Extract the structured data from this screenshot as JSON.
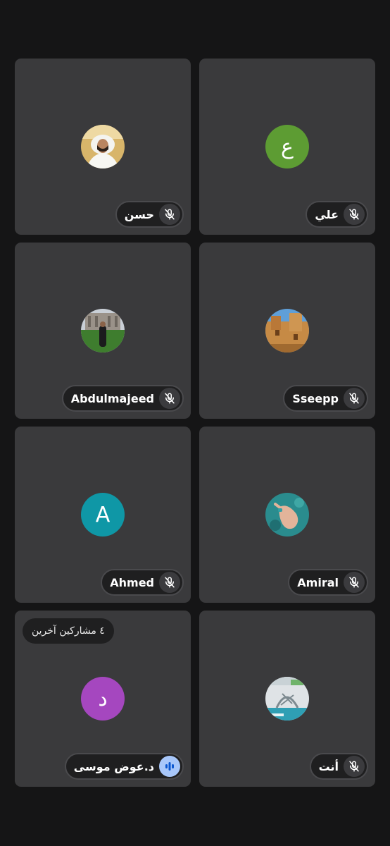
{
  "colors": {
    "background": "#151516",
    "tile": "#3a3a3c",
    "label_bg": "#1f1f20",
    "speaking_badge": "#a8c7fa"
  },
  "participants": [
    {
      "name": "حسن",
      "avatar_type": "photo",
      "avatar_icon": "man-in-white-thobe-photo",
      "mic": "muted"
    },
    {
      "name": "علي",
      "avatar_type": "letter",
      "avatar_letter": "ع",
      "avatar_color": "#5d9c33",
      "mic": "muted"
    },
    {
      "name": "Abdulmajeed",
      "avatar_type": "photo",
      "avatar_icon": "man-standing-on-lawn-photo",
      "mic": "muted"
    },
    {
      "name": "Sseepp",
      "avatar_type": "photo",
      "avatar_icon": "mud-brick-fort-photo",
      "mic": "muted"
    },
    {
      "name": "Ahmed",
      "avatar_type": "letter",
      "avatar_letter": "A",
      "avatar_color": "#0f97a6",
      "mic": "muted"
    },
    {
      "name": "Amiral",
      "avatar_type": "photo",
      "avatar_icon": "hand-over-water-photo",
      "mic": "muted"
    },
    {
      "name": "د.عوض موسى",
      "avatar_type": "letter",
      "avatar_letter": "د",
      "avatar_color": "#a547bf",
      "mic": "speaking",
      "others_label": "٤ مشاركين آخرين"
    },
    {
      "name": "أنت",
      "avatar_type": "photo",
      "avatar_icon": "map-illustration-photo",
      "mic": "muted"
    }
  ]
}
